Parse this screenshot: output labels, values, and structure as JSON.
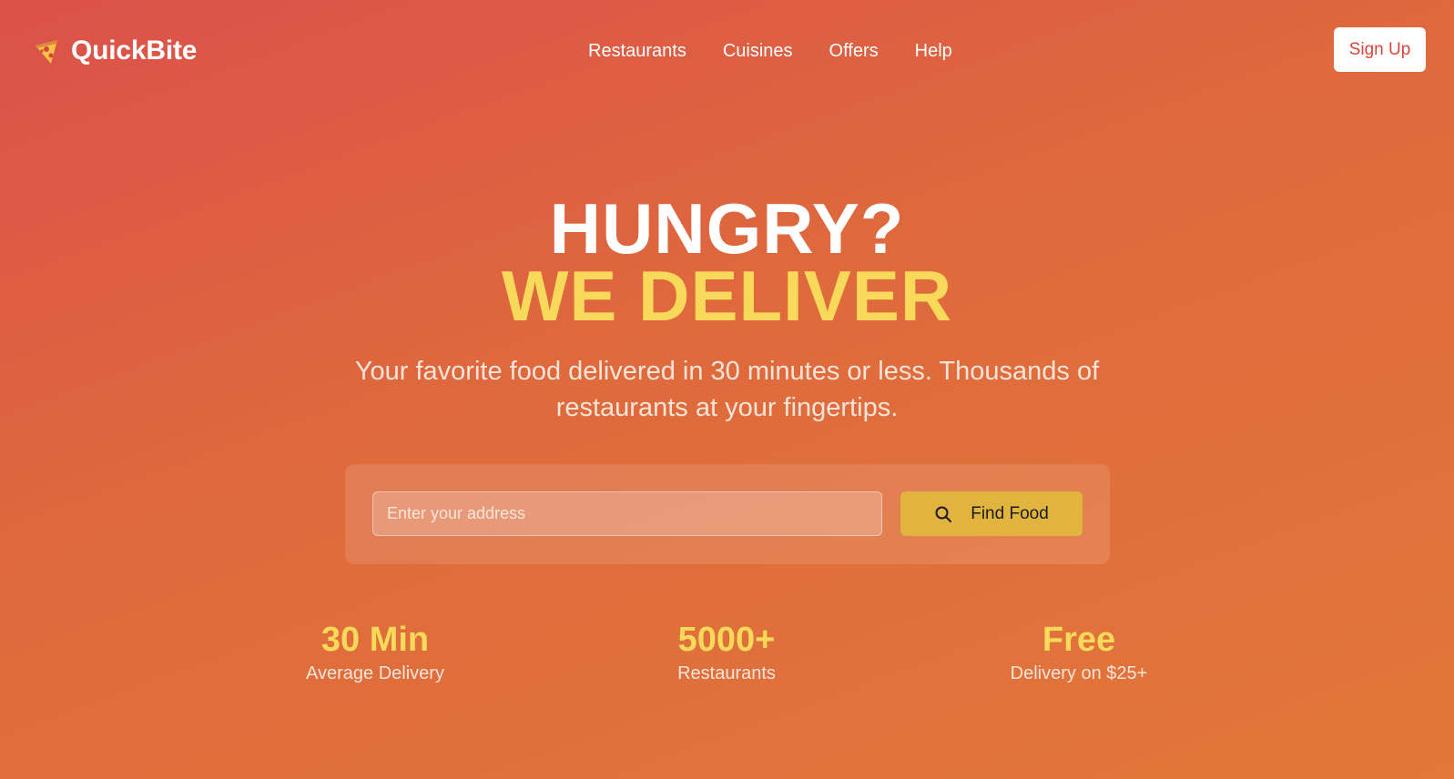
{
  "header": {
    "logo_icon": "pizza-icon",
    "logo_text": "QuickBite",
    "nav": [
      {
        "label": "Restaurants"
      },
      {
        "label": "Cuisines"
      },
      {
        "label": "Offers"
      },
      {
        "label": "Help"
      }
    ],
    "signup_label": "Sign Up"
  },
  "hero": {
    "line1": "HUNGRY?",
    "line2": "WE DELIVER",
    "subtitle": "Your favorite food delivered in 30 minutes or less. Thousands of restaurants at your fingertips."
  },
  "search": {
    "placeholder": "Enter your address",
    "value": "",
    "button_icon": "search-icon",
    "button_label": "Find Food"
  },
  "stats": [
    {
      "value": "30 Min",
      "label": "Average Delivery"
    },
    {
      "value": "5000+",
      "label": "Restaurants"
    },
    {
      "value": "Free",
      "label": "Delivery on $25+"
    }
  ],
  "colors": {
    "gradient_start": "#dc514a",
    "gradient_end": "#e2773a",
    "accent_yellow": "#f8d95a",
    "button_gold": "#e1b43f",
    "signup_text": "#d8453a"
  }
}
